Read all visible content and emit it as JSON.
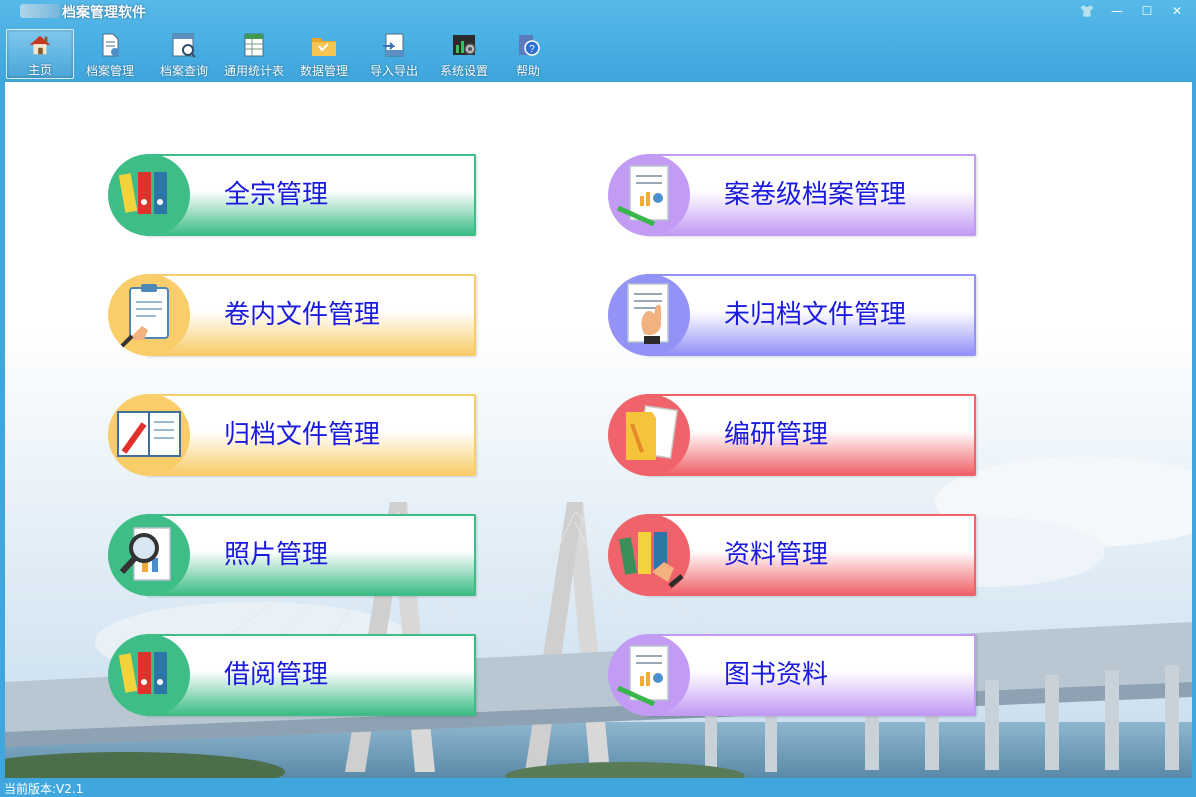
{
  "window": {
    "title": "档案管理软件",
    "buttons": {
      "skin": "👕",
      "minimize": "—",
      "maximize": "☐",
      "close": "✕"
    }
  },
  "toolbar": {
    "items": [
      {
        "label": "主页",
        "icon": "home-icon",
        "active": true
      },
      {
        "label": "档案管理",
        "icon": "document-icon"
      },
      {
        "label": "档案查询",
        "icon": "search-document-icon"
      },
      {
        "label": "通用统计表",
        "icon": "spreadsheet-icon"
      },
      {
        "label": "数据管理",
        "icon": "folder-icon"
      },
      {
        "label": "导入导出",
        "icon": "import-export-icon"
      },
      {
        "label": "系统设置",
        "icon": "settings-icon"
      },
      {
        "label": "帮助",
        "icon": "help-icon"
      }
    ]
  },
  "tiles": {
    "left": [
      {
        "label": "全宗管理",
        "color": "#3fbd86",
        "icon": "binders-icon"
      },
      {
        "label": "卷内文件管理",
        "color": "#f8cd6a",
        "icon": "clipboard-icon"
      },
      {
        "label": "归档文件管理",
        "color": "#f8cd6a",
        "icon": "notebook-icon"
      },
      {
        "label": "照片管理",
        "color": "#3fbd86",
        "icon": "magnifier-icon"
      },
      {
        "label": "借阅管理",
        "color": "#3fbd86",
        "icon": "binders-icon"
      }
    ],
    "right": [
      {
        "label": "案卷级档案管理",
        "color": "#c29cf4",
        "icon": "report-icon"
      },
      {
        "label": "未归档文件管理",
        "color": "#9392f7",
        "icon": "hand-document-icon"
      },
      {
        "label": "编研管理",
        "color": "#f0636a",
        "icon": "folder-pencil-icon"
      },
      {
        "label": "资料管理",
        "color": "#f0636a",
        "icon": "binders-hand-icon"
      },
      {
        "label": "图书资料",
        "color": "#c29cf4",
        "icon": "report-icon"
      }
    ]
  },
  "status": {
    "version": "当前版本:V2.1"
  }
}
